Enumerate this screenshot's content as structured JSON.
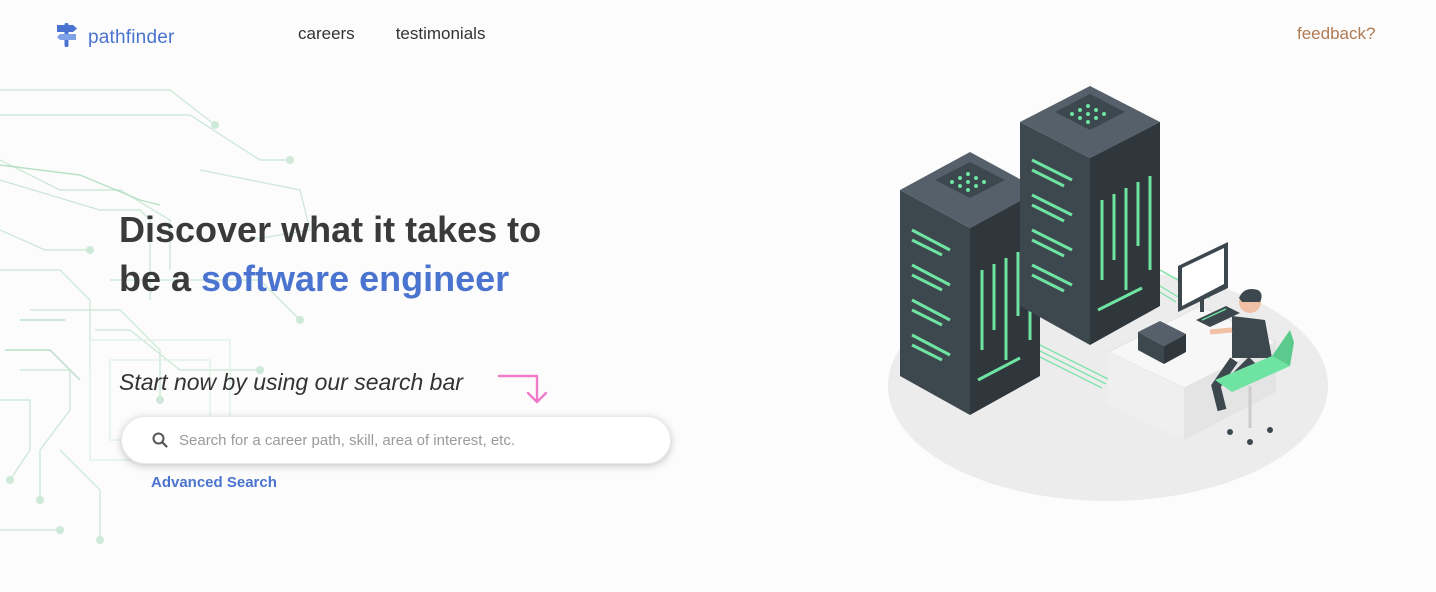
{
  "header": {
    "logo_text": "pathfinder",
    "logo_icon": "signpost-icon",
    "nav": [
      {
        "label": "careers"
      },
      {
        "label": "testimonials"
      }
    ],
    "feedback_label": "feedback?"
  },
  "hero": {
    "title_line1": "Discover what it takes to",
    "title_line2_prefix": "be a ",
    "title_accent": "software engineer",
    "subline": "Start now by using our search bar",
    "arrow_icon": "arrow-down-right-icon"
  },
  "search": {
    "icon": "search-icon",
    "placeholder": "Search for a career path, skill, area of interest, etc.",
    "value": ""
  },
  "advanced_search_label": "Advanced Search",
  "illustration": {
    "name": "server-rack-with-developer-illustration"
  },
  "colors": {
    "brand_blue": "#4a74cf",
    "feedback_brown": "#b07a52",
    "arrow_pink": "#f07ac8",
    "server_dark": "#3d474e",
    "server_green": "#6fe3a1"
  }
}
